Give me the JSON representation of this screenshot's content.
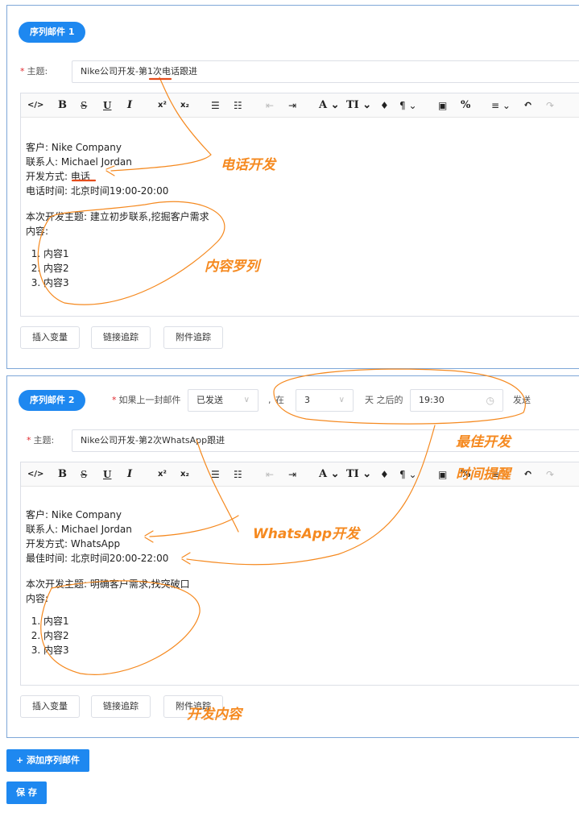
{
  "seq1": {
    "pill": "序列邮件 1",
    "subject_label": "主题:",
    "subject_value": "Nike公司开发-第1次电话跟进",
    "lines": [
      "客户: Nike Company",
      "联系人: Michael Jordan",
      "开发方式: 电话",
      "电话时间: 北京时间19:00-20:00"
    ],
    "topic": "本次开发主题: 建立初步联系,挖掘客户需求",
    "content_label": "内容:",
    "items": [
      "内容1",
      "内容2",
      "内容3"
    ]
  },
  "seq2": {
    "pill": "序列邮件 2",
    "condition_label": "如果上一封邮件",
    "status_value": "已发送",
    "comma": ",",
    "in_label": "在",
    "days_value": "3",
    "days_after_label": "天 之后的",
    "time_value": "19:30",
    "send_label": "发送",
    "subject_label": "主题:",
    "subject_value": "Nike公司开发-第2次WhatsApp跟进",
    "lines": [
      "客户: Nike Company",
      "联系人: Michael Jordan",
      "开发方式: WhatsApp",
      "最佳时间: 北京时间20:00-22:00"
    ],
    "topic": "本次开发主题: 明确客户需求,找突破口",
    "content_label": "内容:",
    "items": [
      "内容1",
      "内容2",
      "内容3"
    ]
  },
  "toolbar": {
    "code": "</>",
    "bold": "B",
    "strike": "S",
    "underline": "U",
    "italic": "I",
    "sup": "x²",
    "sub": "x₂",
    "ul": "☰",
    "ol": "☷",
    "outdent": "⇤",
    "indent": "⇥",
    "fontcolor": "A ⌄",
    "fontsize": "TI ⌄",
    "bg": "♦",
    "para": "¶ ⌄",
    "image": "▣",
    "link": "%",
    "align": "≡ ⌄",
    "undo": "↶",
    "redo": "↷"
  },
  "buttons": {
    "insert_var": "插入变量",
    "link_track": "链接追踪",
    "attach_track": "附件追踪",
    "add_seq": "+ 添加序列邮件",
    "save": "保 存"
  },
  "annotations": {
    "phone": "电话开发",
    "content_list": "内容罗列",
    "best_dev": "最佳开发",
    "time_remind": "时间提醒",
    "whatsapp": "WhatsApp开发",
    "dev_content": "开发内容"
  },
  "colors": {
    "primary": "#1e88f0",
    "annotation": "#f5891f",
    "required": "#e0282e",
    "border": "#7ea7d8"
  }
}
